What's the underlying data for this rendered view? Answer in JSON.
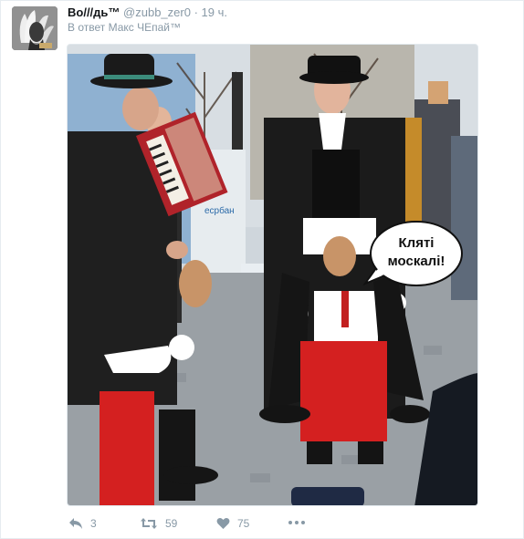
{
  "tweet": {
    "display_name": "Bo///дь™",
    "handle": "@zubb_zer0",
    "separator": "·",
    "time": "19 ч.",
    "reply_to": "В ответ Макс ЧЕпай™"
  },
  "media": {
    "speech_bubble_line1": "Кляті",
    "speech_bubble_line2": "москалі!",
    "sign_text": "есрбан"
  },
  "actions": {
    "reply_count": "3",
    "retweet_count": "59",
    "like_count": "75"
  },
  "icons": {
    "reply": "reply-icon",
    "retweet": "retweet-icon",
    "like": "heart-icon",
    "more": "more-dots-icon"
  },
  "colors": {
    "muted": "#8899a6",
    "name": "#14171a",
    "red_trousers": "#d42020"
  }
}
